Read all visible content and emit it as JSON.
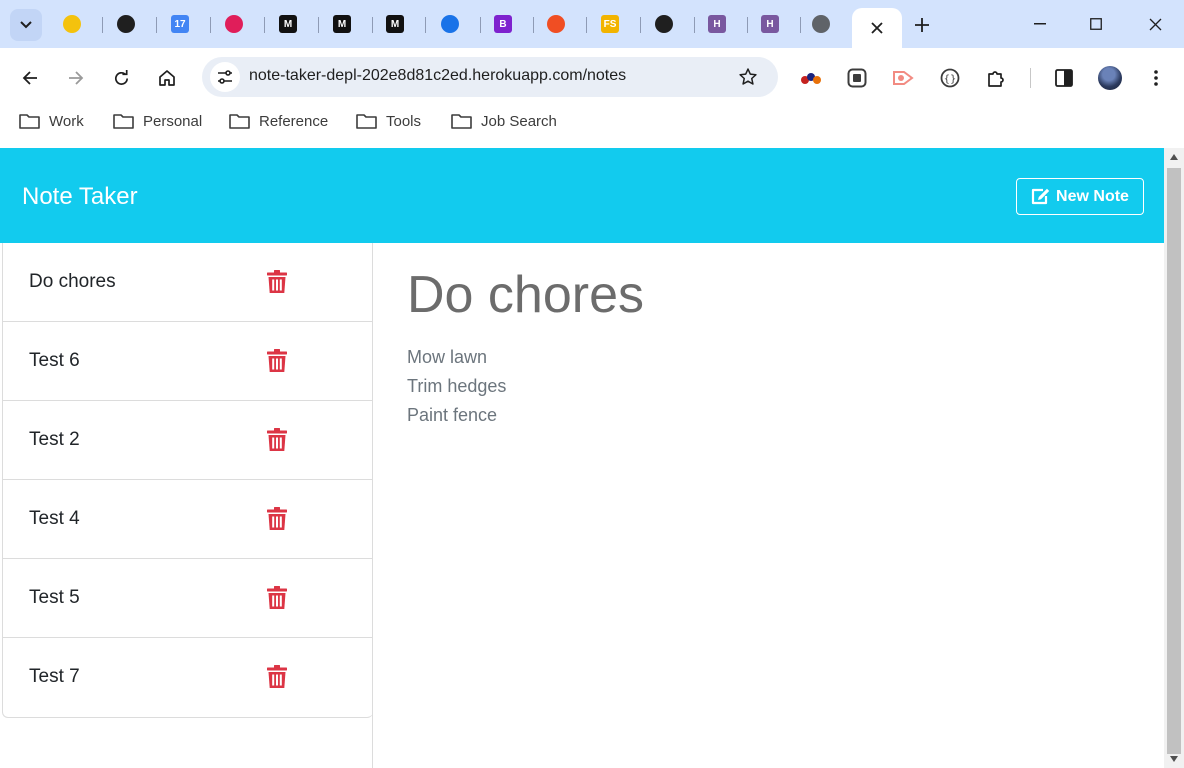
{
  "browser": {
    "address_url": "note-taker-depl-202e8d81c2ed.herokuapp.com/notes",
    "tab_favicons": [
      {
        "name": "lincoln-icon",
        "color": "#f4c20d",
        "glyph": ""
      },
      {
        "name": "github-icon",
        "color": "#1f1f1f",
        "glyph": ""
      },
      {
        "name": "calendar-icon",
        "color": "#4285f4",
        "glyph": "17"
      },
      {
        "name": "slack-icon",
        "color": "#e01e5a",
        "glyph": ""
      },
      {
        "name": "medium-icon",
        "color": "#111111",
        "glyph": "M"
      },
      {
        "name": "medium-icon",
        "color": "#111111",
        "glyph": "M"
      },
      {
        "name": "medium-icon",
        "color": "#111111",
        "glyph": "M"
      },
      {
        "name": "jquery-icon",
        "color": "#1a73e8",
        "glyph": ""
      },
      {
        "name": "bootstrap-icon",
        "color": "#7e22ce",
        "glyph": "B"
      },
      {
        "name": "brave-icon",
        "color": "#f04e23",
        "glyph": ""
      },
      {
        "name": "fs-icon",
        "color": "#f2b400",
        "glyph": "FS"
      },
      {
        "name": "github-icon",
        "color": "#1f1f1f",
        "glyph": ""
      },
      {
        "name": "heroku-icon",
        "color": "#79589f",
        "glyph": "H"
      },
      {
        "name": "heroku-icon",
        "color": "#79589f",
        "glyph": "H"
      },
      {
        "name": "globe-icon",
        "color": "#5f6368",
        "glyph": ""
      }
    ],
    "bookmarks": [
      "Work",
      "Personal",
      "Reference",
      "Tools",
      "Job Search"
    ]
  },
  "app": {
    "brand": "Note Taker",
    "new_note_label": "New Note",
    "accent_color": "#12cbee",
    "delete_color": "#dc3545"
  },
  "notes": [
    {
      "title": "Do chores"
    },
    {
      "title": "Test 6"
    },
    {
      "title": "Test 2"
    },
    {
      "title": "Test 4"
    },
    {
      "title": "Test 5"
    },
    {
      "title": "Test 7"
    }
  ],
  "active_note": {
    "title": "Do chores",
    "text": "Mow lawn\nTrim hedges\nPaint fence"
  }
}
